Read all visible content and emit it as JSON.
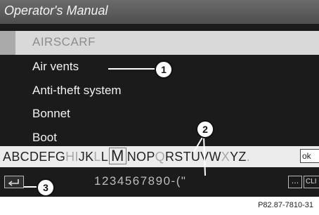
{
  "header": {
    "title": "Operator's Manual"
  },
  "list": {
    "selected": "AIRSCARF",
    "items": [
      "Air vents",
      "Anti-theft system",
      "Bonnet",
      "Boot"
    ]
  },
  "keyboard": {
    "letters": [
      {
        "c": "A",
        "s": "normal"
      },
      {
        "c": "B",
        "s": "normal"
      },
      {
        "c": "C",
        "s": "normal"
      },
      {
        "c": "D",
        "s": "normal"
      },
      {
        "c": "E",
        "s": "normal"
      },
      {
        "c": "F",
        "s": "normal"
      },
      {
        "c": "G",
        "s": "normal"
      },
      {
        "c": "H",
        "s": "dim"
      },
      {
        "c": "I",
        "s": "dim"
      },
      {
        "c": "J",
        "s": "normal"
      },
      {
        "c": "K",
        "s": "normal"
      },
      {
        "c": "L",
        "s": "dim"
      },
      {
        "c": "L",
        "s": "normal"
      },
      {
        "c": "M",
        "s": "selected"
      },
      {
        "c": "N",
        "s": "normal"
      },
      {
        "c": "O",
        "s": "normal"
      },
      {
        "c": "P",
        "s": "normal"
      },
      {
        "c": "Q",
        "s": "dim"
      },
      {
        "c": "R",
        "s": "normal"
      },
      {
        "c": "S",
        "s": "normal"
      },
      {
        "c": "T",
        "s": "normal"
      },
      {
        "c": "U",
        "s": "normal"
      },
      {
        "c": "V",
        "s": "normal"
      },
      {
        "c": "W",
        "s": "normal"
      },
      {
        "c": "X",
        "s": "dim"
      },
      {
        "c": "Y",
        "s": "normal"
      },
      {
        "c": "Z",
        "s": "normal"
      },
      {
        "c": ".",
        "s": "dim"
      }
    ],
    "ok_label": "ok",
    "digits": "1234567890-(\"",
    "ellipsis_label": "...",
    "clear_label": "CLI",
    "back_icon": "back-arrow-icon"
  },
  "callouts": [
    "1",
    "2",
    "3"
  ],
  "figure_ref": "P82.87-7810-31",
  "colors": {
    "screen_bg": "#1b1b1b",
    "title_bar": "#595959",
    "selected_row": "#d9d9d9",
    "keyboard_bar": "#ececec"
  }
}
